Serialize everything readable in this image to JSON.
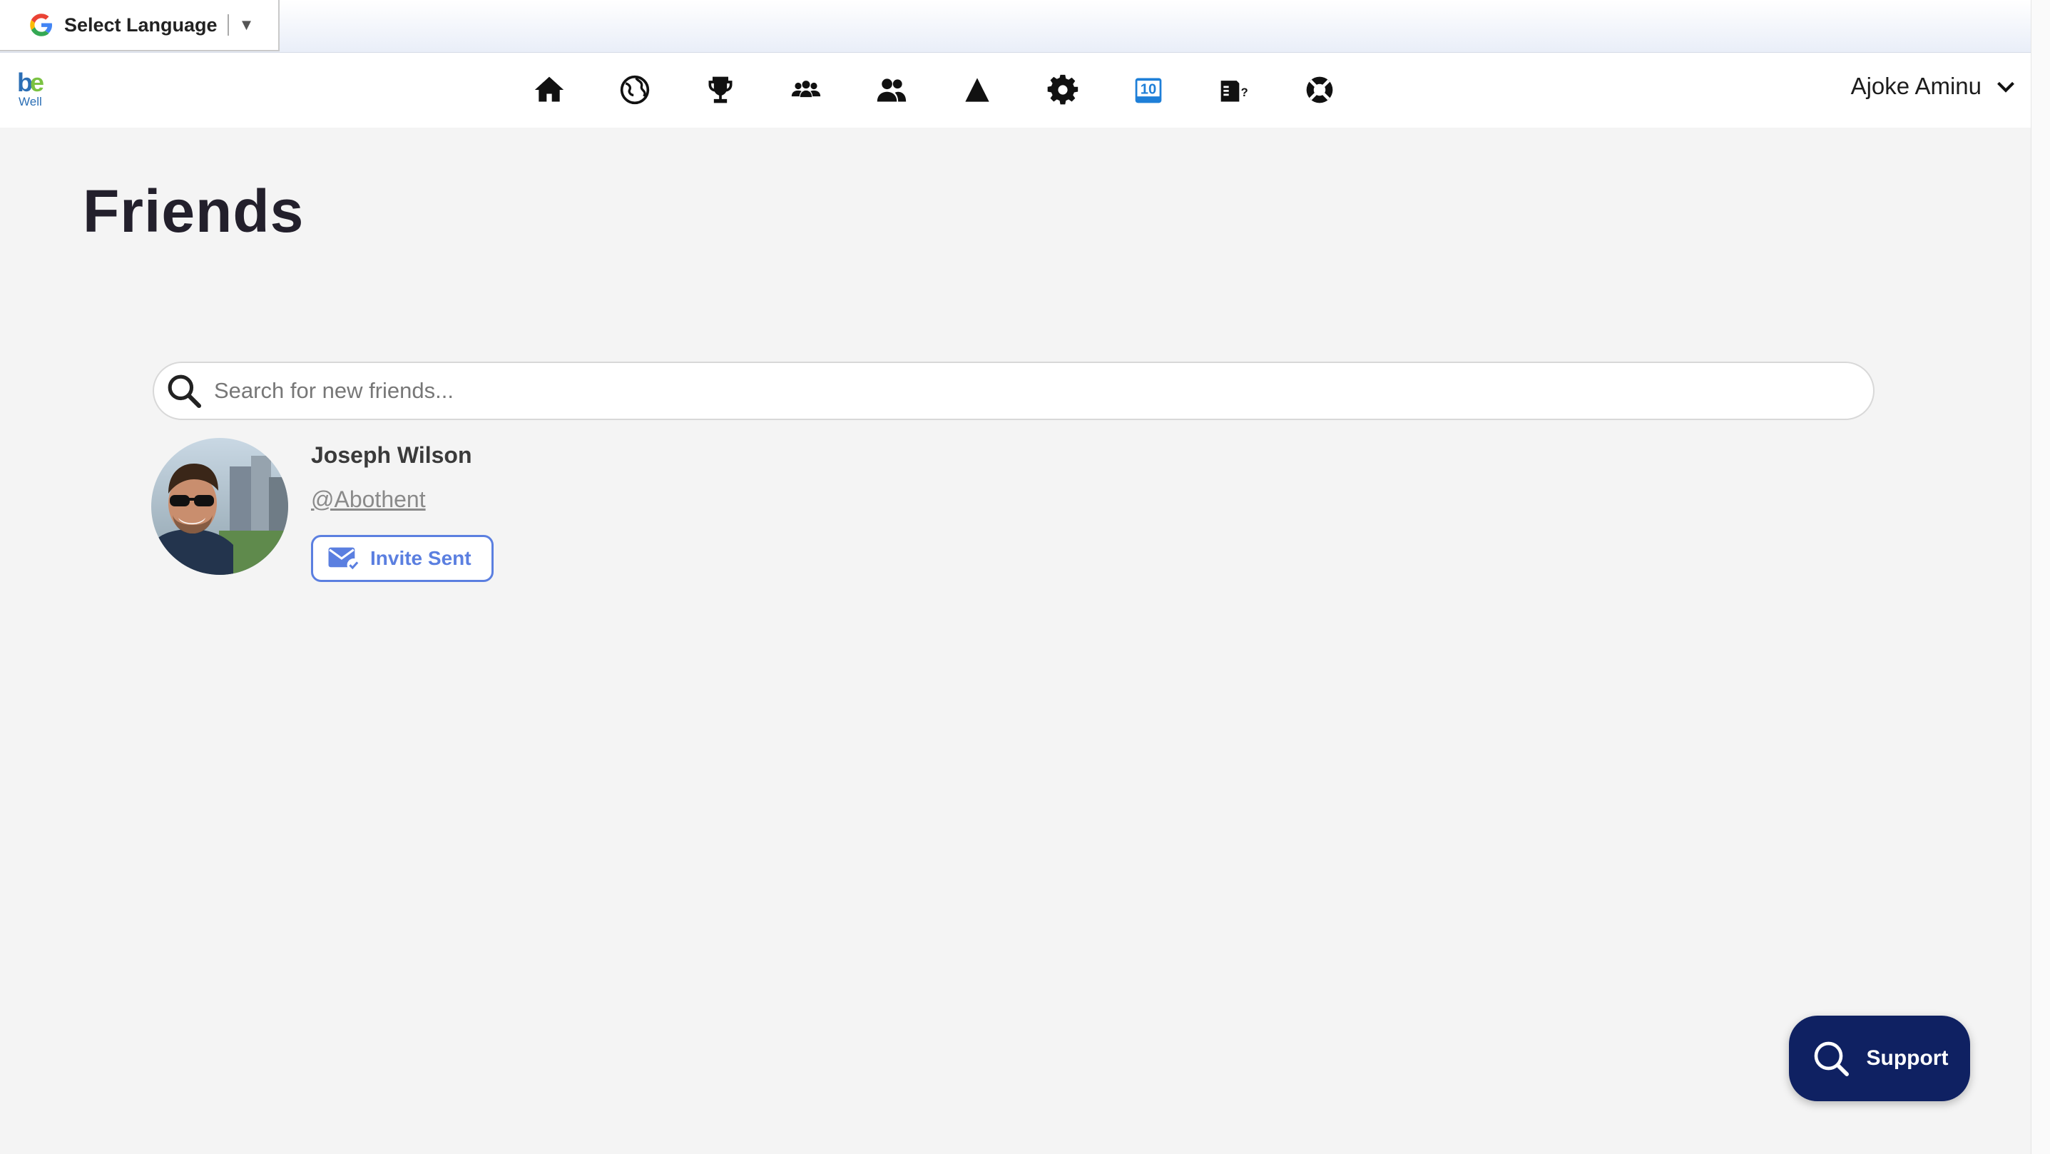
{
  "translate_bar": {
    "label": "Select Language",
    "arrow": "▼"
  },
  "logo": {
    "text_top": "be",
    "text_bottom": "Well"
  },
  "nav": {
    "icons": [
      "home-icon",
      "globe-icon",
      "trophy-icon",
      "community-icon",
      "friends-icon",
      "navigation-arrow-icon",
      "settings-gear-icon",
      "calendar-10-icon",
      "quiz-card-icon",
      "lifebuoy-icon"
    ],
    "calendar_badge": "10"
  },
  "user": {
    "name": "Ajoke Aminu"
  },
  "page": {
    "title": "Friends"
  },
  "search": {
    "placeholder": "Search for new friends..."
  },
  "friends": [
    {
      "name": "Joseph Wilson",
      "handle": "@Abothent",
      "action_label": "Invite Sent"
    }
  ],
  "support": {
    "label": "Support"
  },
  "colors": {
    "accent": "#5b7fe0",
    "support_bg": "#0f2162",
    "background": "#f4f4f4"
  }
}
